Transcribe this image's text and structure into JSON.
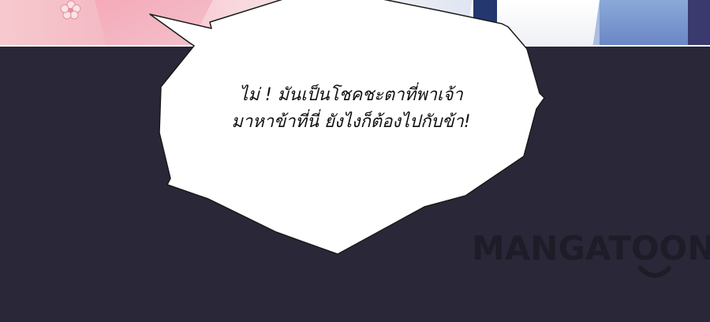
{
  "panel": {
    "background_color": "#2a2738",
    "top_strip_colors": [
      "#f3b7c2",
      "#eef0f6",
      "#6b86c5"
    ]
  },
  "speech_bubble": {
    "line1": "ไม่ ! มันเป็นโชคชะตาที่พาเจ้า",
    "line2": "มาหาข้าที่นี่ ยังไงก็ต้องไปกับข้า!",
    "fill_color": "#ffffff",
    "text_color": "#111111"
  },
  "watermark": {
    "text": "MANGATOON",
    "color": "#1e1c27"
  }
}
